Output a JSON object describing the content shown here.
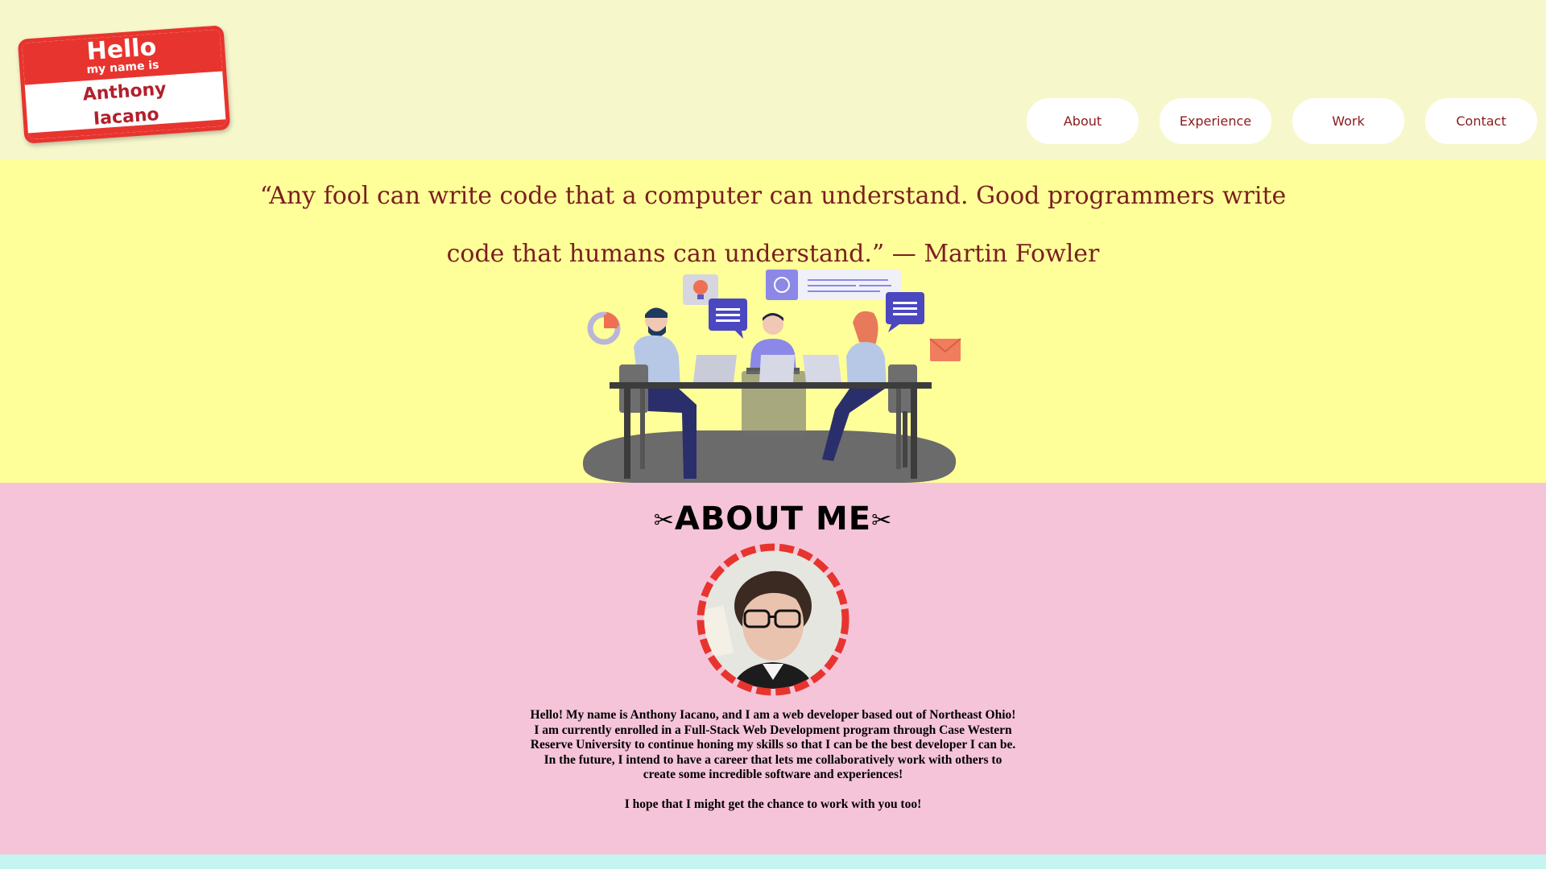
{
  "badge": {
    "hello": "Hello",
    "subtitle": "my name is",
    "first_name": "Anthony",
    "last_name": "Iacano"
  },
  "nav": {
    "items": [
      {
        "label": "About"
      },
      {
        "label": "Experience"
      },
      {
        "label": "Work"
      },
      {
        "label": "Contact"
      }
    ]
  },
  "hero": {
    "quote": "“Any fool can write code that a computer can understand. Good programmers write code that humans can understand.” — Martin Fowler",
    "illustration": "team-meeting-illustration"
  },
  "about": {
    "title": "ABOUT ME",
    "paragraph1": "Hello! My name is Anthony Iacano, and I am a web developer based out of Northeast Ohio! I am currently enrolled in a Full-Stack Web Development program through Case Western Reserve University to continue honing my skills so that I can be the best developer I can be. In the future, I intend to have a career that lets me collaboratively work with others to create some incredible software and experiences!",
    "paragraph2": "I hope that I might get the chance to work with you too!"
  },
  "colors": {
    "header_bg": "#f7f7cc",
    "hero_bg": "#ffff99",
    "about_bg": "#f5c4d8",
    "footer_bg": "#c4f5f0",
    "accent_red": "#e8342e",
    "text_maroon": "#7a1f1f"
  }
}
